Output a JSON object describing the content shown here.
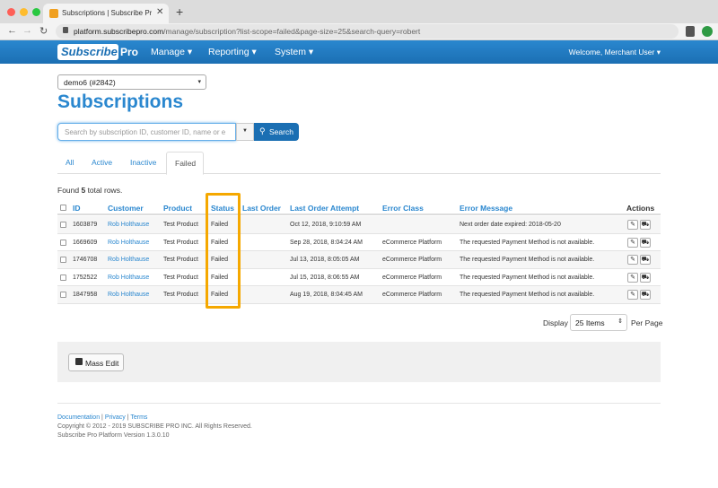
{
  "browser": {
    "tab_title": "Subscriptions | Subscribe Pro",
    "url_host": "platform.subscribepro.com",
    "url_path": "/manage/subscription?list-scope=failed&page-size=25&search-query=robert"
  },
  "navbar": {
    "logo_text": "Subscribe",
    "logo_suffix": "Pro",
    "menu": [
      "Manage ▾",
      "Reporting ▾",
      "System ▾"
    ],
    "welcome": "Welcome, Merchant User ▾"
  },
  "account_select": {
    "value": "demo6 (#2842)"
  },
  "page_title": "Subscriptions",
  "search": {
    "placeholder": "Search by subscription ID, customer ID, name or e",
    "button_label": "Search"
  },
  "tabs": [
    "All",
    "Active",
    "Inactive",
    "Failed"
  ],
  "active_tab": "Failed",
  "found": {
    "prefix": "Found ",
    "count": "5",
    "suffix": " total rows."
  },
  "table": {
    "headers": [
      "ID",
      "Customer",
      "Product",
      "Status",
      "Last Order",
      "Last Order Attempt",
      "Error Class",
      "Error Message",
      "Actions"
    ],
    "rows": [
      {
        "id": "1603879",
        "customer": "Rob Holthause",
        "product": "Test Product",
        "status": "Failed",
        "last_order": "",
        "attempt": "Oct 12, 2018, 9:10:59 AM",
        "error_class": "",
        "error_message": "Next order date expired: 2018-05-20"
      },
      {
        "id": "1669609",
        "customer": "Rob Holthause",
        "product": "Test Product",
        "status": "Failed",
        "last_order": "",
        "attempt": "Sep 28, 2018, 8:04:24 AM",
        "error_class": "eCommerce Platform",
        "error_message": "The requested Payment Method is not available."
      },
      {
        "id": "1746708",
        "customer": "Rob Holthause",
        "product": "Test Product",
        "status": "Failed",
        "last_order": "",
        "attempt": "Jul 13, 2018, 8:05:05 AM",
        "error_class": "eCommerce Platform",
        "error_message": "The requested Payment Method is not available."
      },
      {
        "id": "1752522",
        "customer": "Rob Holthause",
        "product": "Test Product",
        "status": "Failed",
        "last_order": "",
        "attempt": "Jul 15, 2018, 8:06:55 AM",
        "error_class": "eCommerce Platform",
        "error_message": "The requested Payment Method is not available."
      },
      {
        "id": "1847958",
        "customer": "Rob Holthause",
        "product": "Test Product",
        "status": "Failed",
        "last_order": "",
        "attempt": "Aug 19, 2018, 8:04:45 AM",
        "error_class": "eCommerce Platform",
        "error_message": "The requested Payment Method is not available."
      }
    ]
  },
  "per_page": {
    "label_before": "Display",
    "value": "25 Items",
    "label_after": "Per Page"
  },
  "mass_edit_label": "Mass Edit",
  "footer": {
    "links": [
      "Documentation",
      "Privacy",
      "Terms"
    ],
    "separator": " | ",
    "copyright": "Copyright © 2012 - 2019 SUBSCRIBE PRO INC. All Rights Reserved.",
    "version": "Subscribe Pro Platform Version 1.3.0.10"
  },
  "colors": {
    "brand": "#1b6fb3",
    "link": "#2a87cf",
    "highlight": "#f5a800"
  },
  "icons": [
    "lock-icon",
    "search-icon",
    "edit-icon",
    "cart-icon",
    "mass-edit-icon"
  ]
}
